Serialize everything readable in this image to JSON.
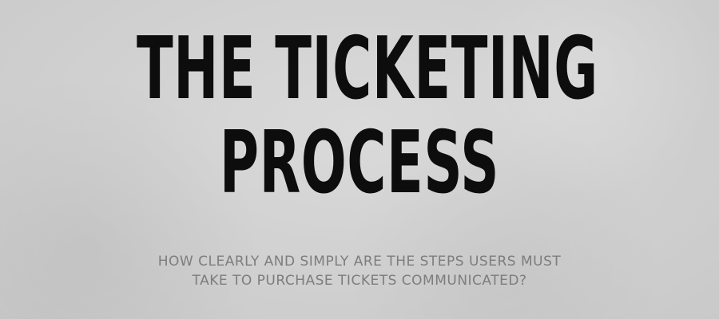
{
  "headline": {
    "line1": "THE TICKETING",
    "line2": "PROCESS"
  },
  "subheading": {
    "line1": "HOW CLEARLY AND SIMPLY ARE THE STEPS USERS MUST",
    "line2": "TAKE TO PURCHASE TICKETS COMMUNICATED?"
  },
  "colors": {
    "background": "#d2d2d2",
    "headline": "#0d0d0d",
    "subheading": "#7d7d7d"
  }
}
